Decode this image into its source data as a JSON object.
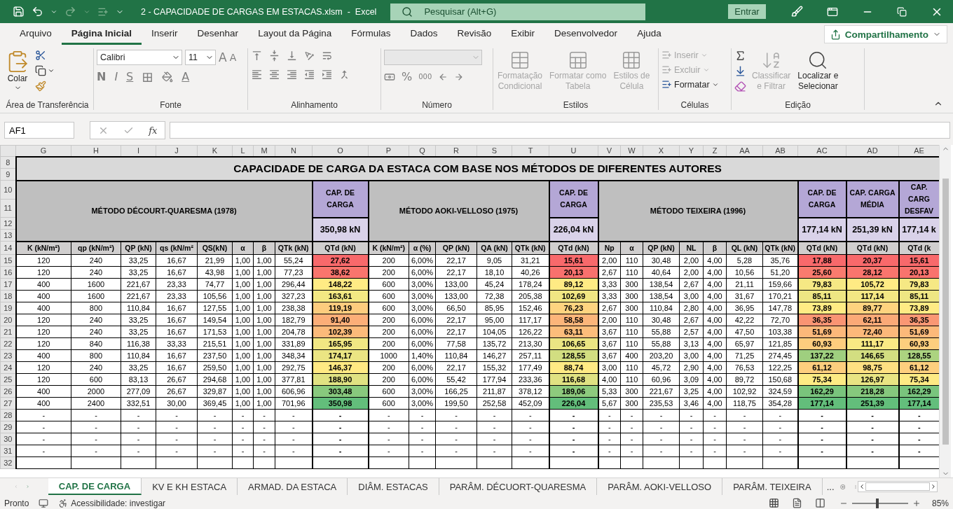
{
  "title_bar": {
    "file_title": "2 - CAPACIDADE DE CARGAS EM ESTACAS.xlsm  -  Excel",
    "search_placeholder": "Pesquisar (Alt+G)",
    "sign_in": "Entrar"
  },
  "ribbon_tabs": [
    {
      "label": "Arquivo",
      "selected": false
    },
    {
      "label": "Página Inicial",
      "selected": true
    },
    {
      "label": "Inserir",
      "selected": false
    },
    {
      "label": "Desenhar",
      "selected": false
    },
    {
      "label": "Layout da Página",
      "selected": false
    },
    {
      "label": "Fórmulas",
      "selected": false
    },
    {
      "label": "Dados",
      "selected": false
    },
    {
      "label": "Revisão",
      "selected": false
    },
    {
      "label": "Exibir",
      "selected": false
    },
    {
      "label": "Desenvolvedor",
      "selected": false
    },
    {
      "label": "Ajuda",
      "selected": false
    }
  ],
  "share_button": "Compartilhamento",
  "ribbon": {
    "clipboard": {
      "label": "Área de Transferência",
      "paste": "Colar"
    },
    "font": {
      "label": "Fonte",
      "name": "Calibri",
      "size": "11",
      "grow": "A",
      "shrink": "A",
      "bold": "N",
      "italic": "I",
      "underline": "S",
      "text_color_letter": "A"
    },
    "alignment": {
      "label": "Alinhamento"
    },
    "number": {
      "label": "Número",
      "percent": "%",
      "thousands": "000"
    },
    "styles": {
      "label": "Estilos",
      "items": [
        {
          "label": "Formatação\nCondicional",
          "disabled": true
        },
        {
          "label": "Formatar como\nTabela",
          "disabled": true
        },
        {
          "label": "Estilos de\nCélula",
          "disabled": true
        }
      ]
    },
    "cells": {
      "label": "Células",
      "items": [
        {
          "label": "Inserir",
          "disabled": true
        },
        {
          "label": "Excluir",
          "disabled": true
        },
        {
          "label": "Formatar",
          "disabled": false
        }
      ]
    },
    "editing": {
      "label": "Edição",
      "items": [
        {
          "label": "Classificar\ne Filtrar",
          "disabled": true
        },
        {
          "label": "Localizar e\nSelecionar",
          "disabled": false
        }
      ]
    }
  },
  "formula_bar": {
    "name_box": "AF1",
    "fx": "fx"
  },
  "sheet": {
    "column_letters": [
      "G",
      "H",
      "I",
      "J",
      "K",
      "L",
      "M",
      "N",
      "O",
      "P",
      "Q",
      "R",
      "S",
      "T",
      "U",
      "V",
      "W",
      "X",
      "Y",
      "Z",
      "AA",
      "AB",
      "AC",
      "AD",
      "AE"
    ],
    "title_rows": [
      "8",
      "9"
    ],
    "title": "CAPACIDADE DE CARGA DA ESTACA COM BASE NOS MÉTODOS DE DIFERENTES AUTORES",
    "header_rows": [
      "10",
      "11",
      "12",
      "13"
    ],
    "column_header_row": "14",
    "groups": [
      {
        "kind": "method",
        "label": "MÉTODO DÉCOURT-QUARESMA (1978)",
        "columns": [
          "K (kN/m²)",
          "qp (kN/m²)",
          "QP (kN)",
          "qs (kN/m²",
          "QS(kN)",
          "α",
          "β",
          "QTk (kN)"
        ]
      },
      {
        "kind": "result",
        "label": "CAP. DE\nCARGA",
        "value": "350,98 kN",
        "columns": [
          "QTd (kN)"
        ]
      },
      {
        "kind": "method",
        "label": "MÉTODO AOKI-VELLOSO (1975)",
        "columns": [
          "K (kN/m²)",
          "α (%)",
          "QP (kN)",
          "QA (kN)",
          "QTk (kN)"
        ]
      },
      {
        "kind": "result",
        "label": "CAP. DE\nCARGA",
        "value": "226,04 kN",
        "columns": [
          "QTd (kN)"
        ]
      },
      {
        "kind": "method",
        "label": "MÉTODO TEIXEIRA (1996)",
        "columns": [
          "Np",
          "α",
          "QP (kN)",
          "NL",
          "β",
          "QL (kN)",
          "QTk (kN)"
        ]
      },
      {
        "kind": "result",
        "label": "CAP. DE\nCARGA",
        "value": "177,14 kN",
        "columns": [
          "QTd (kN)"
        ]
      },
      {
        "kind": "result",
        "label": "CAP. CARGA\nMÉDIA",
        "value": "251,39 kN",
        "columns": [
          "QTd (kN)"
        ]
      },
      {
        "kind": "result",
        "label": "CAP. CARG\nDESFAV",
        "value": "177,14 k",
        "columns": [
          "QTd (k"
        ]
      }
    ],
    "rows": [
      {
        "number": "15",
        "cells": [
          "120",
          "240",
          "33,25",
          "16,67",
          "21,99",
          "1,00",
          "1,00",
          "55,24",
          {
            "value": "27,62",
            "color": "#f8696b"
          },
          "200",
          "6,00%",
          "22,17",
          "9,05",
          "31,21",
          {
            "value": "15,61",
            "color": "#f8696b"
          },
          "2,00",
          "110",
          "30,48",
          "2,00",
          "4,00",
          "5,28",
          "35,76",
          {
            "value": "17,88",
            "color": "#f8696b"
          },
          {
            "value": "20,37",
            "color": "#f8696b"
          },
          {
            "value": "15,61",
            "color": "#f8696b"
          }
        ]
      },
      {
        "number": "16",
        "cells": [
          "120",
          "240",
          "33,25",
          "16,67",
          "43,98",
          "1,00",
          "1,00",
          "77,23",
          {
            "value": "38,62",
            "color": "#f9756d"
          },
          "200",
          "6,00%",
          "22,17",
          "18,10",
          "40,26",
          {
            "value": "20,13",
            "color": "#f8716d"
          },
          "2,67",
          "110",
          "40,64",
          "2,00",
          "4,00",
          "10,56",
          "51,20",
          {
            "value": "25,60",
            "color": "#f97b6e"
          },
          {
            "value": "28,12",
            "color": "#f9756d"
          },
          {
            "value": "20,13",
            "color": "#f9736d"
          }
        ]
      },
      {
        "number": "17",
        "cells": [
          "400",
          "1600",
          "221,67",
          "23,33",
          "74,77",
          "1,00",
          "1,00",
          "296,44",
          {
            "value": "148,22",
            "color": "#ffeb84"
          },
          "600",
          "3,00%",
          "133,00",
          "45,24",
          "178,24",
          {
            "value": "89,12",
            "color": "#ffeb84"
          },
          "3,33",
          "300",
          "138,54",
          "2,67",
          "4,00",
          "21,11",
          "159,66",
          {
            "value": "79,83",
            "color": "#f6e884"
          },
          {
            "value": "105,72",
            "color": "#ffeb84"
          },
          {
            "value": "79,83",
            "color": "#f6e884"
          }
        ]
      },
      {
        "number": "18",
        "cells": [
          "400",
          "1600",
          "221,67",
          "23,33",
          "105,56",
          "1,00",
          "1,00",
          "327,23",
          {
            "value": "163,61",
            "color": "#f3e883"
          },
          "600",
          "3,00%",
          "133,00",
          "72,38",
          "205,38",
          {
            "value": "102,69",
            "color": "#f0e683"
          },
          "3,33",
          "300",
          "138,54",
          "3,00",
          "4,00",
          "31,67",
          "170,21",
          {
            "value": "85,11",
            "color": "#eee683"
          },
          {
            "value": "117,14",
            "color": "#f3e783"
          },
          {
            "value": "85,11",
            "color": "#eee683"
          }
        ]
      },
      {
        "number": "19",
        "cells": [
          "400",
          "800",
          "110,84",
          "16,67",
          "127,55",
          "1,00",
          "1,00",
          "238,38",
          {
            "value": "119,19",
            "color": "#fdcc7e"
          },
          "600",
          "3,00%",
          "66,50",
          "85,95",
          "152,46",
          {
            "value": "76,23",
            "color": "#fed480"
          },
          "2,67",
          "300",
          "110,84",
          "2,80",
          "4,00",
          "36,95",
          "147,78",
          {
            "value": "73,89",
            "color": "#ffeb84"
          },
          {
            "value": "89,77",
            "color": "#fed37f"
          },
          {
            "value": "73,89",
            "color": "#ffeb84"
          }
        ]
      },
      {
        "number": "20",
        "cells": [
          "120",
          "240",
          "33,25",
          "16,67",
          "149,54",
          "1,00",
          "1,00",
          "182,79",
          {
            "value": "91,40",
            "color": "#fcae78"
          },
          "200",
          "6,00%",
          "22,17",
          "95,00",
          "117,17",
          {
            "value": "58,58",
            "color": "#fcb57a"
          },
          "2,00",
          "110",
          "30,48",
          "2,67",
          "4,00",
          "42,22",
          "72,70",
          {
            "value": "36,35",
            "color": "#fa9473"
          },
          {
            "value": "62,11",
            "color": "#fba977"
          },
          {
            "value": "36,35",
            "color": "#fa9774"
          }
        ]
      },
      {
        "number": "21",
        "cells": [
          "120",
          "240",
          "33,25",
          "16,67",
          "171,53",
          "1,00",
          "1,00",
          "204,78",
          {
            "value": "102,39",
            "color": "#fcba7a"
          },
          "200",
          "6,00%",
          "22,17",
          "104,05",
          "126,22",
          {
            "value": "63,11",
            "color": "#fcbd7b"
          },
          "3,67",
          "110",
          "55,88",
          "2,57",
          "4,00",
          "47,50",
          "103,38",
          {
            "value": "51,69",
            "color": "#fcb87a"
          },
          {
            "value": "72,40",
            "color": "#fcb87a"
          },
          {
            "value": "51,69",
            "color": "#fcb97a"
          }
        ]
      },
      {
        "number": "22",
        "cells": [
          "120",
          "840",
          "116,38",
          "33,33",
          "215,51",
          "1,00",
          "1,00",
          "331,89",
          {
            "value": "165,95",
            "color": "#f1e783"
          },
          "200",
          "6,00%",
          "77,58",
          "135,72",
          "213,30",
          {
            "value": "106,65",
            "color": "#ebe583"
          },
          "3,67",
          "110",
          "55,88",
          "3,13",
          "4,00",
          "65,97",
          "121,85",
          {
            "value": "60,93",
            "color": "#fdcd7e"
          },
          {
            "value": "111,17",
            "color": "#f9e984"
          },
          {
            "value": "60,93",
            "color": "#fdce7e"
          }
        ]
      },
      {
        "number": "23",
        "cells": [
          "400",
          "800",
          "110,84",
          "16,67",
          "237,50",
          "1,00",
          "1,00",
          "348,34",
          {
            "value": "174,17",
            "color": "#ebe583"
          },
          "1000",
          "1,40%",
          "110,84",
          "146,27",
          "257,11",
          {
            "value": "128,55",
            "color": "#d2de81"
          },
          "3,67",
          "400",
          "203,20",
          "3,00",
          "4,00",
          "71,25",
          "274,45",
          {
            "value": "137,22",
            "color": "#9fcf7f"
          },
          {
            "value": "146,65",
            "color": "#d3de81"
          },
          {
            "value": "128,55",
            "color": "#acd380"
          }
        ]
      },
      {
        "number": "24",
        "cells": [
          "120",
          "240",
          "33,25",
          "16,67",
          "259,50",
          "1,00",
          "1,00",
          "292,75",
          {
            "value": "146,37",
            "color": "#ffe983"
          },
          "200",
          "6,00%",
          "22,17",
          "155,32",
          "177,49",
          {
            "value": "88,74",
            "color": "#ffea84"
          },
          "3,00",
          "110",
          "45,72",
          "2,90",
          "4,00",
          "76,53",
          "122,25",
          {
            "value": "61,12",
            "color": "#fdce7e"
          },
          {
            "value": "98,75",
            "color": "#fee082"
          },
          {
            "value": "61,12",
            "color": "#fdcf7e"
          }
        ]
      },
      {
        "number": "25",
        "cells": [
          "120",
          "600",
          "83,13",
          "26,67",
          "294,68",
          "1,00",
          "1,00",
          "377,81",
          {
            "value": "188,90",
            "color": "#e0e282"
          },
          "200",
          "6,00%",
          "55,42",
          "177,94",
          "233,36",
          {
            "value": "116,68",
            "color": "#e0e282"
          },
          "4,00",
          "110",
          "60,96",
          "3,09",
          "4,00",
          "89,72",
          "150,68",
          {
            "value": "75,34",
            "color": "#fdeb84"
          },
          {
            "value": "126,97",
            "color": "#e8e483"
          },
          {
            "value": "75,34",
            "color": "#fdea84"
          }
        ]
      },
      {
        "number": "26",
        "cells": [
          "400",
          "2000",
          "277,09",
          "26,67",
          "329,87",
          "1,00",
          "1,00",
          "606,96",
          {
            "value": "303,48",
            "color": "#88c97d"
          },
          "600",
          "3,00%",
          "166,25",
          "211,87",
          "378,12",
          {
            "value": "189,06",
            "color": "#8dca7d"
          },
          "5,33",
          "300",
          "221,67",
          "3,25",
          "4,00",
          "102,92",
          "324,59",
          {
            "value": "162,29",
            "color": "#79c47c"
          },
          {
            "value": "218,28",
            "color": "#86c87d"
          },
          {
            "value": "162,29",
            "color": "#79c47d"
          }
        ]
      },
      {
        "number": "27",
        "cells": [
          "400",
          "2400",
          "332,51",
          "30,00",
          "369,45",
          "1,00",
          "1,00",
          "701,96",
          {
            "value": "350,98",
            "color": "#63be7b"
          },
          "600",
          "3,00%",
          "199,50",
          "252,58",
          "452,09",
          {
            "value": "226,04",
            "color": "#63be7b"
          },
          "5,67",
          "300",
          "235,53",
          "3,46",
          "4,00",
          "118,75",
          "354,28",
          {
            "value": "177,14",
            "color": "#63be7b"
          },
          {
            "value": "251,39",
            "color": "#63be7b"
          },
          {
            "value": "177,14",
            "color": "#63be7c"
          }
        ]
      },
      {
        "number": "28",
        "cells": [
          "-",
          "-",
          "-",
          "-",
          "-",
          "-",
          "-",
          "-",
          "-",
          "-",
          "-",
          "-",
          "-",
          "-",
          "-",
          "-",
          "-",
          "-",
          "-",
          "-",
          "-",
          "-",
          "-",
          "-",
          "-"
        ]
      },
      {
        "number": "29",
        "cells": [
          "-",
          "-",
          "-",
          "-",
          "-",
          "-",
          "-",
          "-",
          "-",
          "-",
          "-",
          "-",
          "-",
          "-",
          "-",
          "-",
          "-",
          "-",
          "-",
          "-",
          "-",
          "-",
          "-",
          "-",
          "-"
        ]
      },
      {
        "number": "30",
        "cells": [
          "-",
          "-",
          "-",
          "-",
          "-",
          "-",
          "-",
          "-",
          "-",
          "-",
          "-",
          "-",
          "-",
          "-",
          "-",
          "-",
          "-",
          "-",
          "-",
          "-",
          "-",
          "-",
          "-",
          "-",
          "-"
        ]
      },
      {
        "number": "31",
        "cells": [
          "-",
          "-",
          "-",
          "-",
          "-",
          "-",
          "-",
          "-",
          "-",
          "-",
          "-",
          "-",
          "-",
          "-",
          "-",
          "-",
          "-",
          "-",
          "-",
          "-",
          "-",
          "-",
          "-",
          "-",
          "-"
        ]
      },
      {
        "number": "32"
      }
    ]
  },
  "sheet_tabs": [
    {
      "label": "CAP. DE CARGA",
      "selected": true
    },
    {
      "label": "KV E KH ESTACA",
      "selected": false
    },
    {
      "label": "ARMAD. DA ESTACA",
      "selected": false
    },
    {
      "label": "DIÂM. ESTACAS",
      "selected": false
    },
    {
      "label": "PARÂM. DÉCUORT-QUARESMA",
      "selected": false
    },
    {
      "label": "PARÂM. AOKI-VELLOSO",
      "selected": false
    },
    {
      "label": "PARÂM. TEIXEIRA",
      "selected": false
    }
  ],
  "more_tabs": "...",
  "status_bar": {
    "status": "Pronto",
    "accessibility": "Acessibilidade: investigar",
    "zoom": {
      "level": 0.45,
      "reading": "85%"
    }
  }
}
